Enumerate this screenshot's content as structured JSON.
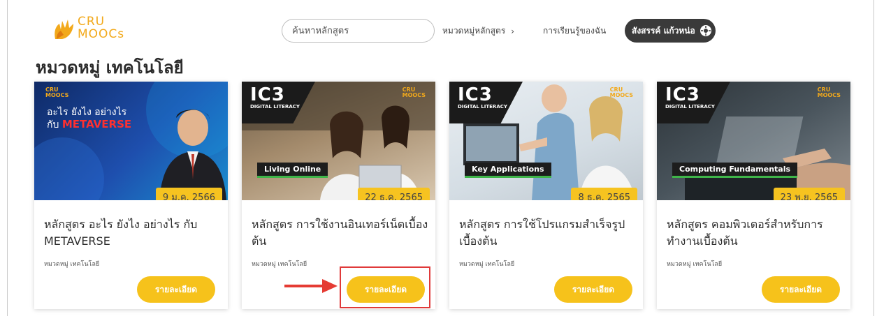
{
  "header": {
    "logo": {
      "line1": "CRU",
      "line2": "MOOCs"
    },
    "search": {
      "placeholder": "ค้นหาหลักสูตร"
    },
    "nav": {
      "categories": "หมวดหมู่หลักสูตร",
      "chevron": "›",
      "my_learning": "การเรียนรู้ของฉัน"
    },
    "user": {
      "name": "สังสรรค์ แก้วหน่อ"
    }
  },
  "page_title": "หมวดหมู่ เทคโนโลยี",
  "cards": [
    {
      "thumb_title_line1": "อะไร ยังไง อย่างไร",
      "thumb_title_line2": "กับ",
      "thumb_title_highlight": "METAVERSE",
      "date": "9 ม.ค. 2566",
      "title": "หลักสูตร อะไร ยังไง อย่างไร กับ METAVERSE",
      "category": "หมวดหมู่ เทคโนโลยี",
      "button": "รายละเอียด"
    },
    {
      "thumb_ic3": "IC3",
      "thumb_ic3_sub": "DIGITAL LITERACY",
      "thumb_caption": "Living Online",
      "date": "22 ธ.ค. 2565",
      "title": "หลักสูตร การใช้งานอินเทอร์เน็ตเบื้องต้น",
      "category": "หมวดหมู่ เทคโนโลยี",
      "button": "รายละเอียด"
    },
    {
      "thumb_ic3": "IC3",
      "thumb_ic3_sub": "DIGITAL LITERACY",
      "thumb_caption": "Key Applications",
      "date": "8 ธ.ค. 2565",
      "title": "หลักสูตร การใช้โปรแกรมสำเร็จรูปเบื้องต้น",
      "category": "หมวดหมู่ เทคโนโลยี",
      "button": "รายละเอียด"
    },
    {
      "thumb_ic3": "IC3",
      "thumb_ic3_sub": "DIGITAL LITERACY",
      "thumb_caption": "Computing Fundamentals",
      "date": "23 พ.ย. 2565",
      "title": "หลักสูตร คอมพิวเตอร์สำหรับการทำงานเบื้องต้น",
      "category": "หมวดหมู่ เทคโนโลยี",
      "button": "รายละเอียด"
    }
  ],
  "colors": {
    "accent": "#f6c21b",
    "highlight_border": "#e03a3a",
    "user_pill": "#3a3a3a"
  }
}
